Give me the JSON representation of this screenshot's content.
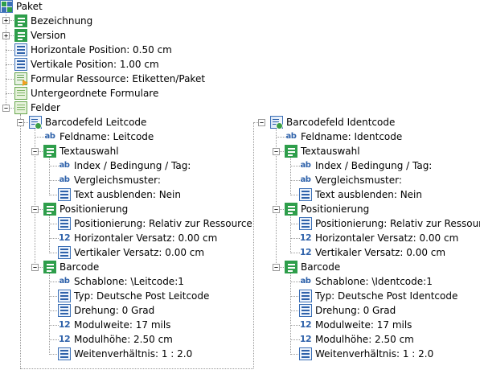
{
  "root": "Paket",
  "bezeichnung": "Bezeichnung",
  "version": "Version",
  "horiz_pos": "Horizontale Position:  0.50 cm",
  "vert_pos": "Vertikale Position:  1.00 cm",
  "formular": "Formular Ressource:  Etiketten/Paket",
  "untergeordnet": "Untergeordnete Formulare",
  "felder": "Felder",
  "fields": [
    {
      "title": "Barcodefeld  Leitcode",
      "feldname": "Feldname:  Leitcode",
      "textauswahl": "Textauswahl",
      "index": "Index / Bedingung / Tag:",
      "vergleich": "Vergleichsmuster:",
      "ausblenden": "Text ausblenden:  Nein",
      "positionierung": "Positionierung",
      "pos_value": "Positionierung:  Relativ zur Ressource",
      "h_versatz": "Horizontaler Versatz:  0.00 cm",
      "v_versatz": "Vertikaler Versatz:  0.00 cm",
      "barcode": "Barcode",
      "schablone": "Schablone:  \\Leitcode:1",
      "typ": "Typ:  Deutsche Post Leitcode",
      "drehung": "Drehung:  0 Grad",
      "modulweite": "Modulweite:  17 mils",
      "modulhoehe": "Modulhöhe:  2.50 cm",
      "weitenverh": "Weitenverhältnis:  1 : 2.0"
    },
    {
      "title": "Barcodefeld  Identcode",
      "feldname": "Feldname:  Identcode",
      "textauswahl": "Textauswahl",
      "index": "Index / Bedingung / Tag:",
      "vergleich": "Vergleichsmuster:",
      "ausblenden": "Text ausblenden:  Nein",
      "positionierung": "Positionierung",
      "pos_value": "Positionierung:  Relativ zur Ressource",
      "h_versatz": "Horizontaler Versatz:  0.00 cm",
      "v_versatz": "Vertikaler Versatz:  0.00 cm",
      "barcode": "Barcode",
      "schablone": "Schablone:  \\Identcode:1",
      "typ": "Typ:  Deutsche Post Identcode",
      "drehung": "Drehung:  0 Grad",
      "modulweite": "Modulweite:  17 mils",
      "modulhoehe": "Modulhöhe:  2.50 cm",
      "weitenverh": "Weitenverhältnis:  1 : 2.0"
    }
  ],
  "icons": {
    "ab": "ab",
    "num": "12",
    "plus": "+",
    "minus": "−"
  }
}
